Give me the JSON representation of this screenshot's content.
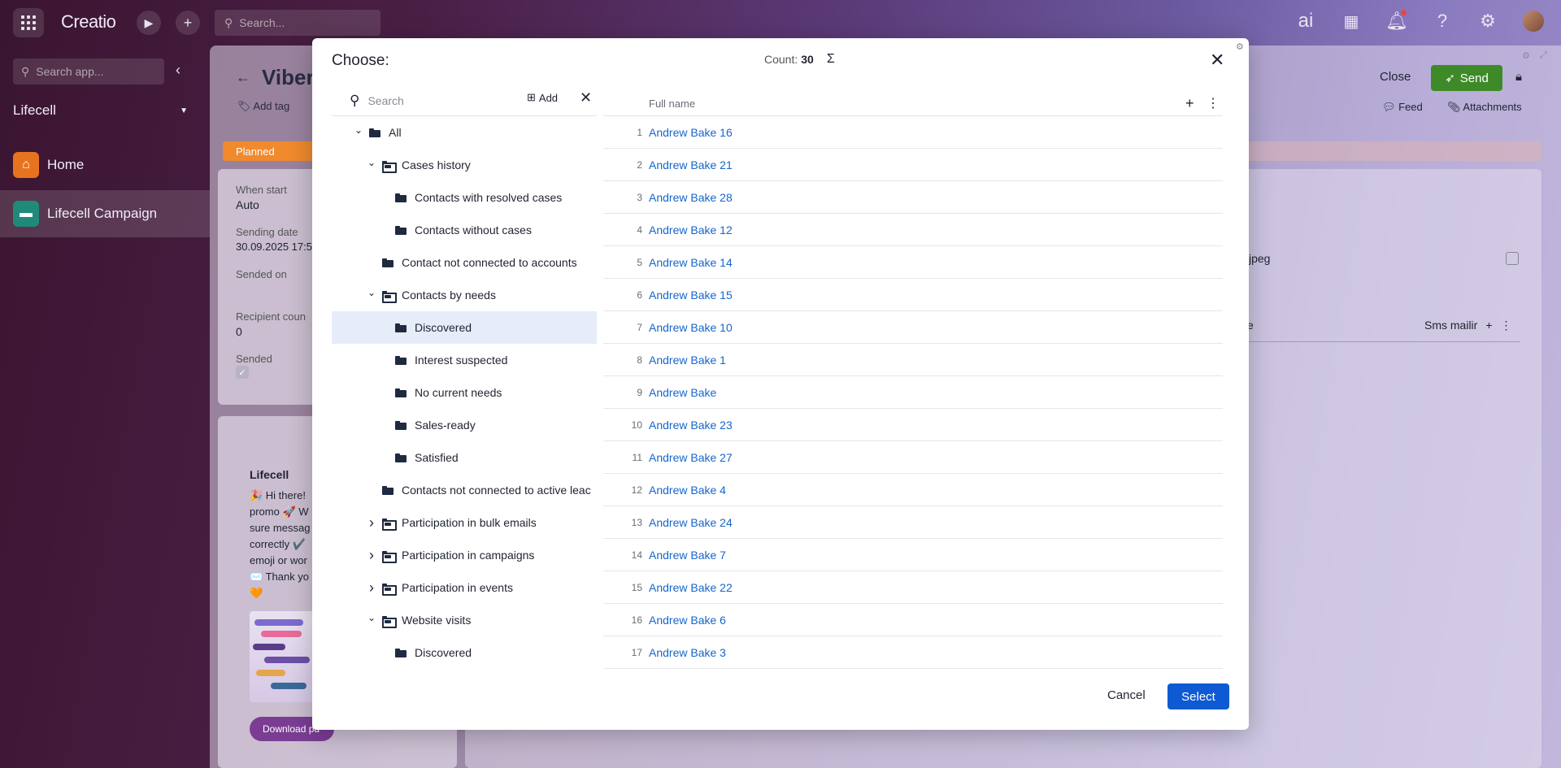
{
  "app": {
    "brand": "Creatio",
    "search_placeholder": "Search...",
    "ai_label": "ai"
  },
  "sidebar": {
    "search_placeholder": "Search app...",
    "workspace": "Lifecell",
    "items": [
      {
        "label": "Home",
        "icon": "home-icon",
        "color": "#e8731f"
      },
      {
        "label": "Lifecell Campaign",
        "icon": "chat-icon",
        "color": "#1f8a7a"
      }
    ]
  },
  "background_page": {
    "title": "Viber",
    "add_tag": "Add tag",
    "status": "Planned",
    "fields": [
      {
        "label": "When start",
        "value": "Auto"
      },
      {
        "label": "Sending date",
        "value": "30.09.2025 17:5"
      },
      {
        "label": "Sended on",
        "value": ""
      },
      {
        "label": "Recipient coun",
        "value": "0"
      },
      {
        "label": "Sended",
        "value": ""
      }
    ],
    "message_title": "Lifecell",
    "message_text": "🎉 Hi there! promo 🚀 W sure messag correctly ✔️ emoji or wor ✉️ Thank yo 🧡",
    "download_label": "Download pd",
    "close_label": "Close",
    "send_label": "Send",
    "feed_label": "Feed",
    "attachments_label": "Attachments",
    "file_label": "jpeg",
    "table_col_e": "e",
    "sms_label": "Sms mailir"
  },
  "modal": {
    "title": "Choose:",
    "count_label": "Count:",
    "count_value": "30",
    "search_placeholder": "Search",
    "add_label": "Add",
    "column_header": "Full name",
    "cancel_label": "Cancel",
    "select_label": "Select",
    "tree": [
      {
        "label": "All",
        "level": 0,
        "chevron": "down",
        "folder": "static",
        "selected": false
      },
      {
        "label": "Cases history",
        "level": 1,
        "chevron": "down",
        "folder": "dynamic",
        "selected": false
      },
      {
        "label": "Contacts with resolved cases",
        "level": 2,
        "chevron": "",
        "folder": "static",
        "selected": false
      },
      {
        "label": "Contacts without cases",
        "level": 2,
        "chevron": "",
        "folder": "static",
        "selected": false
      },
      {
        "label": "Contact not connected to accounts",
        "level": 1,
        "chevron": "",
        "folder": "static",
        "selected": false
      },
      {
        "label": "Contacts by needs",
        "level": 1,
        "chevron": "down",
        "folder": "dynamic",
        "selected": false
      },
      {
        "label": "Discovered",
        "level": 2,
        "chevron": "",
        "folder": "static",
        "selected": true
      },
      {
        "label": "Interest suspected",
        "level": 2,
        "chevron": "",
        "folder": "static",
        "selected": false
      },
      {
        "label": "No current needs",
        "level": 2,
        "chevron": "",
        "folder": "static",
        "selected": false
      },
      {
        "label": "Sales-ready",
        "level": 2,
        "chevron": "",
        "folder": "static",
        "selected": false
      },
      {
        "label": "Satisfied",
        "level": 2,
        "chevron": "",
        "folder": "static",
        "selected": false
      },
      {
        "label": "Contacts not connected to active leac",
        "level": 1,
        "chevron": "",
        "folder": "static",
        "selected": false
      },
      {
        "label": "Participation in bulk emails",
        "level": 1,
        "chevron": "right",
        "folder": "dynamic",
        "selected": false
      },
      {
        "label": "Participation in campaigns",
        "level": 1,
        "chevron": "right",
        "folder": "dynamic",
        "selected": false
      },
      {
        "label": "Participation in events",
        "level": 1,
        "chevron": "right",
        "folder": "dynamic",
        "selected": false
      },
      {
        "label": "Website visits",
        "level": 1,
        "chevron": "down",
        "folder": "dynamic",
        "selected": false
      },
      {
        "label": "Discovered",
        "level": 2,
        "chevron": "",
        "folder": "static",
        "selected": false
      }
    ],
    "rows": [
      {
        "num": "1",
        "name": "Andrew Bake 16"
      },
      {
        "num": "2",
        "name": "Andrew Bake 21"
      },
      {
        "num": "3",
        "name": "Andrew Bake 28"
      },
      {
        "num": "4",
        "name": "Andrew Bake 12"
      },
      {
        "num": "5",
        "name": "Andrew Bake 14"
      },
      {
        "num": "6",
        "name": "Andrew Bake 15"
      },
      {
        "num": "7",
        "name": "Andrew Bake 10"
      },
      {
        "num": "8",
        "name": "Andrew Bake 1"
      },
      {
        "num": "9",
        "name": "Andrew Bake"
      },
      {
        "num": "10",
        "name": "Andrew Bake 23"
      },
      {
        "num": "11",
        "name": "Andrew Bake 27"
      },
      {
        "num": "12",
        "name": "Andrew Bake 4"
      },
      {
        "num": "13",
        "name": "Andrew Bake 24"
      },
      {
        "num": "14",
        "name": "Andrew Bake 7"
      },
      {
        "num": "15",
        "name": "Andrew Bake 22"
      },
      {
        "num": "16",
        "name": "Andrew Bake 6"
      },
      {
        "num": "17",
        "name": "Andrew Bake 3"
      }
    ]
  },
  "colors": {
    "accent": "#0d5ad2",
    "link": "#1566cc",
    "send": "#3f8a28",
    "planned": "#f08a2c",
    "selected_row": "#e6ecf8"
  }
}
